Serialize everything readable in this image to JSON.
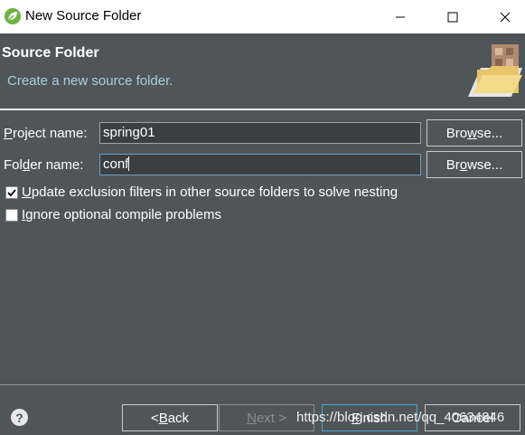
{
  "window": {
    "title": "New Source Folder"
  },
  "header": {
    "title": "Source Folder",
    "description": "Create a new source folder."
  },
  "form": {
    "project_label_pre": "P",
    "project_label_post": "roject name:",
    "project_value": "spring01",
    "folder_label_pre": "Fol",
    "folder_label_u": "d",
    "folder_label_post": "er name:",
    "folder_value": "conf",
    "browse1_pre": "Bro",
    "browse1_u": "w",
    "browse1_post": "se...",
    "browse2_pre": "Br",
    "browse2_u": "o",
    "browse2_post": "wse...",
    "opt1_u": "U",
    "opt1_post": "pdate exclusion filters in other source folders to solve nesting",
    "opt1_checked": true,
    "opt2_u": "I",
    "opt2_post": "gnore optional compile problems",
    "opt2_checked": false
  },
  "footer": {
    "back_pre": "< ",
    "back_u": "B",
    "back_post": "ack",
    "next_u": "N",
    "next_post": "ext >",
    "finish_u": "F",
    "finish_post": "inish",
    "cancel_label": "Cancel",
    "watermark": "https://blog.csdn.net/qq_40634846"
  }
}
